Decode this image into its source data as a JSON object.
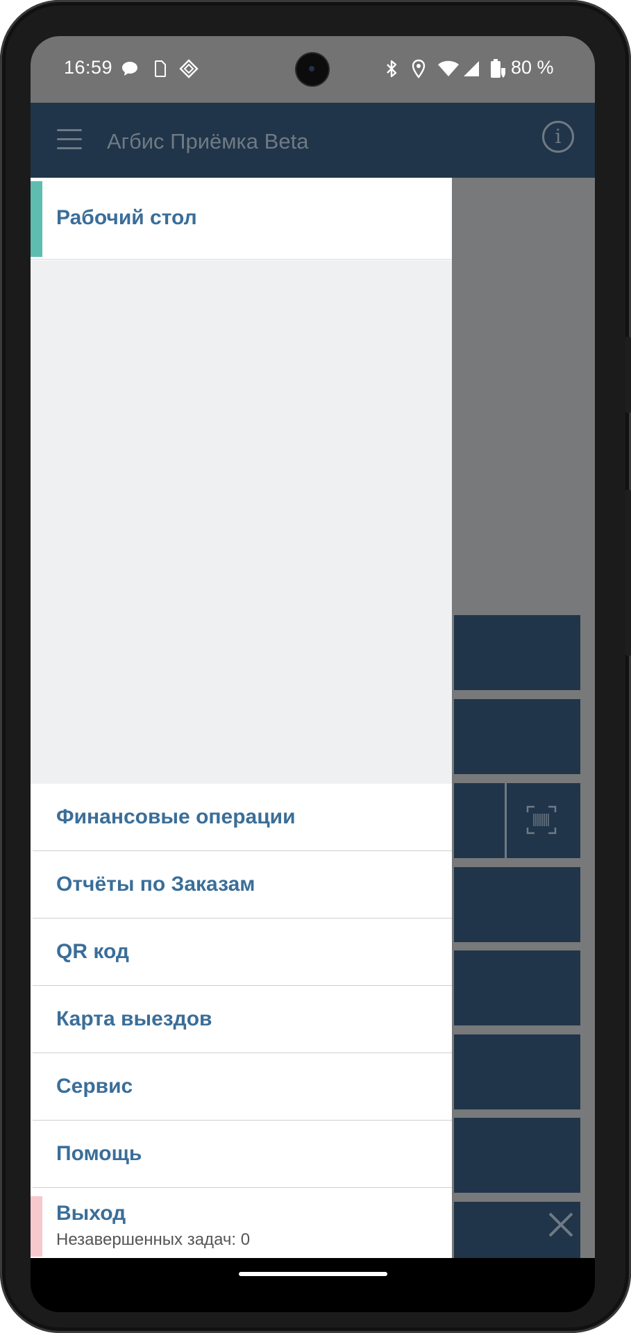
{
  "status_bar": {
    "time": "16:59",
    "battery_text": "80 %",
    "icons": [
      "chat-bubble-icon",
      "sim-icon",
      "diamond-grid-icon",
      "bluetooth-icon",
      "location-icon",
      "wifi-icon",
      "cellular-icon",
      "battery-charging-icon"
    ]
  },
  "app_bar": {
    "title": "Агбис Приёмка Beta",
    "left_icon": "menu-icon",
    "right_icon": "info-icon"
  },
  "drawer": {
    "header_item": "Рабочий стол",
    "items": [
      "Финансовые операции",
      "Отчёты по Заказам",
      "QR код",
      "Карта выездов",
      "Сервис",
      "Помощь"
    ],
    "logout": {
      "label": "Выход",
      "subtitle": "Незавершенных задач: 0"
    }
  },
  "colors": {
    "app_bar": "#203549",
    "drawer_text": "#3a6e99",
    "active_marker": "#5fbdb0",
    "logout_marker": "#f7c9cf",
    "status_bar": "#737373"
  }
}
